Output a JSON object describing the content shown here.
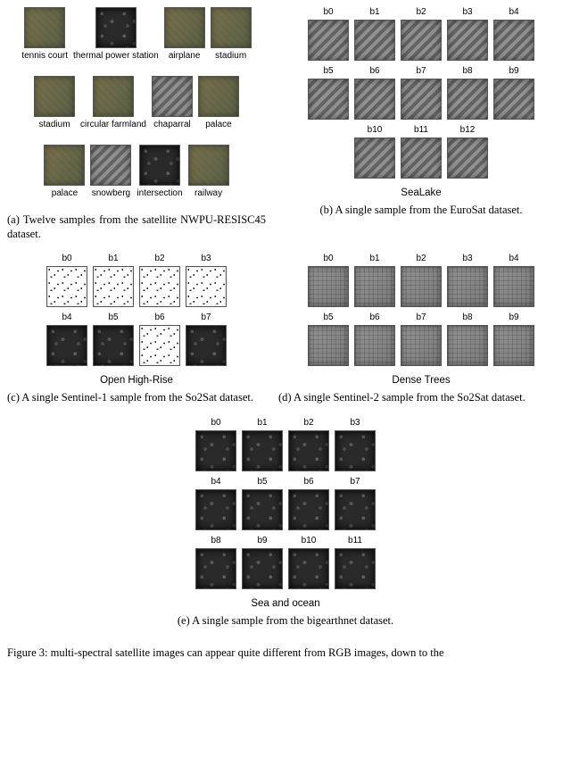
{
  "subfigA": {
    "caption": "(a) Twelve samples from the satellite NWPU-RESISC45 dataset.",
    "labels": [
      [
        "tennis court",
        "thermal power station",
        "airplane",
        "stadium"
      ],
      [
        "stadium",
        "circular farmland",
        "chaparral",
        "palace"
      ],
      [
        "palace",
        "snowberg",
        "intersection",
        "railway"
      ]
    ]
  },
  "subfigB": {
    "caption": "(b) A single sample from the EuroSat dataset.",
    "class": "SeaLake",
    "bands": [
      [
        "b0",
        "b1",
        "b2",
        "b3",
        "b4"
      ],
      [
        "b5",
        "b6",
        "b7",
        "b8",
        "b9"
      ],
      [
        "b10",
        "b11",
        "b12"
      ]
    ]
  },
  "subfigC": {
    "caption": "(c) A single Sentinel-1 sample from the So2Sat dataset.",
    "class": "Open High-Rise",
    "bands": [
      [
        "b0",
        "b1",
        "b2",
        "b3"
      ],
      [
        "b4",
        "b5",
        "b6",
        "b7"
      ]
    ],
    "styles": [
      [
        "white",
        "white",
        "white",
        "white"
      ],
      [
        "dark",
        "dark",
        "white",
        "dark"
      ]
    ]
  },
  "subfigD": {
    "caption": "(d) A single Sentinel-2 sample from the So2Sat dataset.",
    "class": "Dense Trees",
    "bands": [
      [
        "b0",
        "b1",
        "b2",
        "b3",
        "b4"
      ],
      [
        "b5",
        "b6",
        "b7",
        "b8",
        "b9"
      ]
    ]
  },
  "subfigE": {
    "caption": "(e) A single sample from the bigearthnet dataset.",
    "class": "Sea and ocean",
    "bands": [
      [
        "b0",
        "b1",
        "b2",
        "b3"
      ],
      [
        "b4",
        "b5",
        "b6",
        "b7"
      ],
      [
        "b8",
        "b9",
        "b10",
        "b11"
      ]
    ]
  },
  "mainCaption": "Figure 3:   multi-spectral satellite images can appear quite different from RGB images, down to the"
}
